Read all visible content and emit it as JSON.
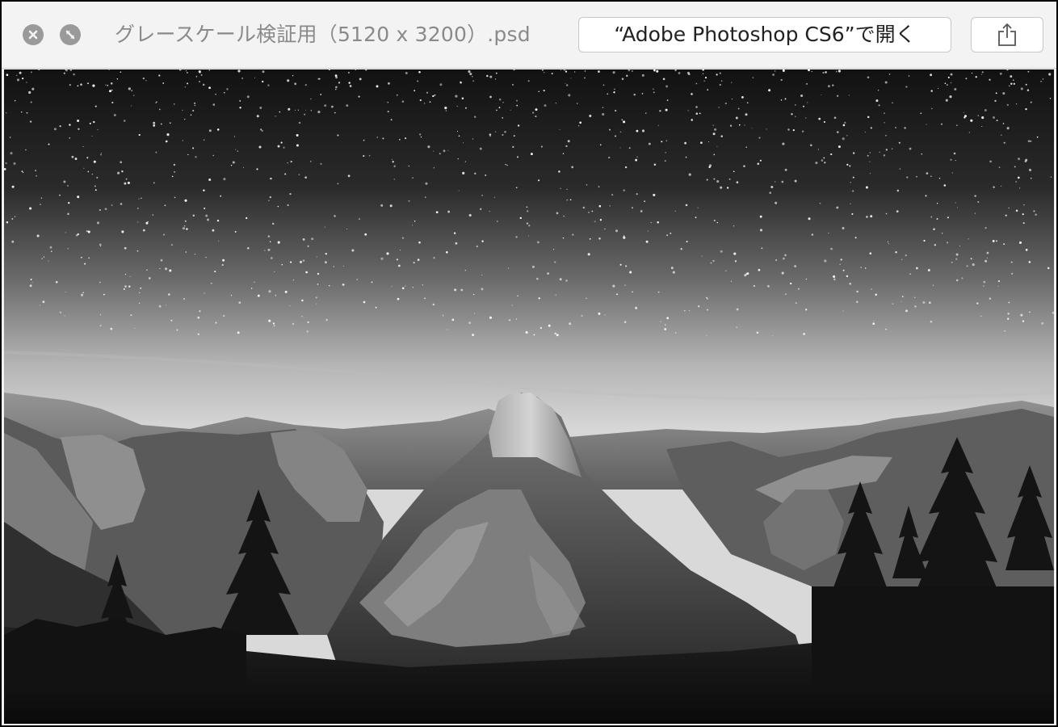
{
  "window": {
    "title": "グレースケール検証用（5120 x 3200）.psd",
    "open_button_label": "“Adobe Photoshop CS6”で開く"
  },
  "controls": {
    "close_icon": "close-icon",
    "fullscreen_icon": "fullscreen-icon",
    "share_icon": "share-icon"
  },
  "preview": {
    "subject": "grayscale landscape photo: starry night sky over granite mountains with dark pine trees"
  }
}
